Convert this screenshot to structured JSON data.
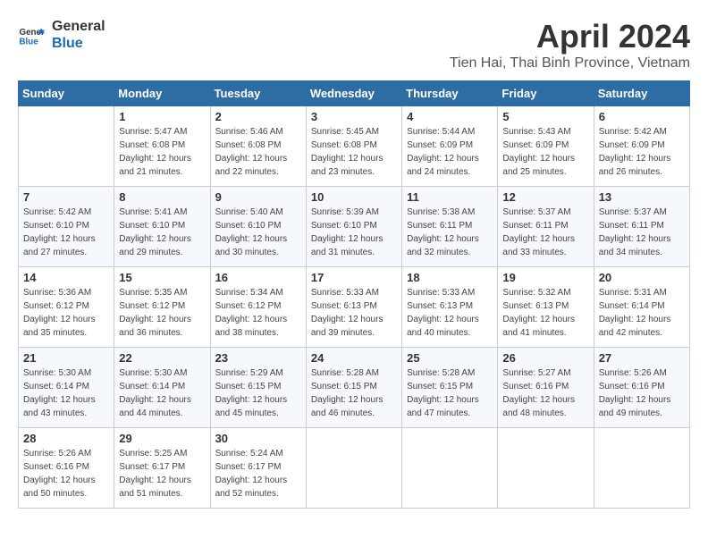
{
  "header": {
    "logo_line1": "General",
    "logo_line2": "Blue",
    "month_title": "April 2024",
    "location": "Tien Hai, Thai Binh Province, Vietnam"
  },
  "days_of_week": [
    "Sunday",
    "Monday",
    "Tuesday",
    "Wednesday",
    "Thursday",
    "Friday",
    "Saturday"
  ],
  "weeks": [
    [
      {
        "day": "",
        "sunrise": "",
        "sunset": "",
        "daylight": ""
      },
      {
        "day": "1",
        "sunrise": "Sunrise: 5:47 AM",
        "sunset": "Sunset: 6:08 PM",
        "daylight": "Daylight: 12 hours and 21 minutes."
      },
      {
        "day": "2",
        "sunrise": "Sunrise: 5:46 AM",
        "sunset": "Sunset: 6:08 PM",
        "daylight": "Daylight: 12 hours and 22 minutes."
      },
      {
        "day": "3",
        "sunrise": "Sunrise: 5:45 AM",
        "sunset": "Sunset: 6:08 PM",
        "daylight": "Daylight: 12 hours and 23 minutes."
      },
      {
        "day": "4",
        "sunrise": "Sunrise: 5:44 AM",
        "sunset": "Sunset: 6:09 PM",
        "daylight": "Daylight: 12 hours and 24 minutes."
      },
      {
        "day": "5",
        "sunrise": "Sunrise: 5:43 AM",
        "sunset": "Sunset: 6:09 PM",
        "daylight": "Daylight: 12 hours and 25 minutes."
      },
      {
        "day": "6",
        "sunrise": "Sunrise: 5:42 AM",
        "sunset": "Sunset: 6:09 PM",
        "daylight": "Daylight: 12 hours and 26 minutes."
      }
    ],
    [
      {
        "day": "7",
        "sunrise": "Sunrise: 5:42 AM",
        "sunset": "Sunset: 6:10 PM",
        "daylight": "Daylight: 12 hours and 27 minutes."
      },
      {
        "day": "8",
        "sunrise": "Sunrise: 5:41 AM",
        "sunset": "Sunset: 6:10 PM",
        "daylight": "Daylight: 12 hours and 29 minutes."
      },
      {
        "day": "9",
        "sunrise": "Sunrise: 5:40 AM",
        "sunset": "Sunset: 6:10 PM",
        "daylight": "Daylight: 12 hours and 30 minutes."
      },
      {
        "day": "10",
        "sunrise": "Sunrise: 5:39 AM",
        "sunset": "Sunset: 6:10 PM",
        "daylight": "Daylight: 12 hours and 31 minutes."
      },
      {
        "day": "11",
        "sunrise": "Sunrise: 5:38 AM",
        "sunset": "Sunset: 6:11 PM",
        "daylight": "Daylight: 12 hours and 32 minutes."
      },
      {
        "day": "12",
        "sunrise": "Sunrise: 5:37 AM",
        "sunset": "Sunset: 6:11 PM",
        "daylight": "Daylight: 12 hours and 33 minutes."
      },
      {
        "day": "13",
        "sunrise": "Sunrise: 5:37 AM",
        "sunset": "Sunset: 6:11 PM",
        "daylight": "Daylight: 12 hours and 34 minutes."
      }
    ],
    [
      {
        "day": "14",
        "sunrise": "Sunrise: 5:36 AM",
        "sunset": "Sunset: 6:12 PM",
        "daylight": "Daylight: 12 hours and 35 minutes."
      },
      {
        "day": "15",
        "sunrise": "Sunrise: 5:35 AM",
        "sunset": "Sunset: 6:12 PM",
        "daylight": "Daylight: 12 hours and 36 minutes."
      },
      {
        "day": "16",
        "sunrise": "Sunrise: 5:34 AM",
        "sunset": "Sunset: 6:12 PM",
        "daylight": "Daylight: 12 hours and 38 minutes."
      },
      {
        "day": "17",
        "sunrise": "Sunrise: 5:33 AM",
        "sunset": "Sunset: 6:13 PM",
        "daylight": "Daylight: 12 hours and 39 minutes."
      },
      {
        "day": "18",
        "sunrise": "Sunrise: 5:33 AM",
        "sunset": "Sunset: 6:13 PM",
        "daylight": "Daylight: 12 hours and 40 minutes."
      },
      {
        "day": "19",
        "sunrise": "Sunrise: 5:32 AM",
        "sunset": "Sunset: 6:13 PM",
        "daylight": "Daylight: 12 hours and 41 minutes."
      },
      {
        "day": "20",
        "sunrise": "Sunrise: 5:31 AM",
        "sunset": "Sunset: 6:14 PM",
        "daylight": "Daylight: 12 hours and 42 minutes."
      }
    ],
    [
      {
        "day": "21",
        "sunrise": "Sunrise: 5:30 AM",
        "sunset": "Sunset: 6:14 PM",
        "daylight": "Daylight: 12 hours and 43 minutes."
      },
      {
        "day": "22",
        "sunrise": "Sunrise: 5:30 AM",
        "sunset": "Sunset: 6:14 PM",
        "daylight": "Daylight: 12 hours and 44 minutes."
      },
      {
        "day": "23",
        "sunrise": "Sunrise: 5:29 AM",
        "sunset": "Sunset: 6:15 PM",
        "daylight": "Daylight: 12 hours and 45 minutes."
      },
      {
        "day": "24",
        "sunrise": "Sunrise: 5:28 AM",
        "sunset": "Sunset: 6:15 PM",
        "daylight": "Daylight: 12 hours and 46 minutes."
      },
      {
        "day": "25",
        "sunrise": "Sunrise: 5:28 AM",
        "sunset": "Sunset: 6:15 PM",
        "daylight": "Daylight: 12 hours and 47 minutes."
      },
      {
        "day": "26",
        "sunrise": "Sunrise: 5:27 AM",
        "sunset": "Sunset: 6:16 PM",
        "daylight": "Daylight: 12 hours and 48 minutes."
      },
      {
        "day": "27",
        "sunrise": "Sunrise: 5:26 AM",
        "sunset": "Sunset: 6:16 PM",
        "daylight": "Daylight: 12 hours and 49 minutes."
      }
    ],
    [
      {
        "day": "28",
        "sunrise": "Sunrise: 5:26 AM",
        "sunset": "Sunset: 6:16 PM",
        "daylight": "Daylight: 12 hours and 50 minutes."
      },
      {
        "day": "29",
        "sunrise": "Sunrise: 5:25 AM",
        "sunset": "Sunset: 6:17 PM",
        "daylight": "Daylight: 12 hours and 51 minutes."
      },
      {
        "day": "30",
        "sunrise": "Sunrise: 5:24 AM",
        "sunset": "Sunset: 6:17 PM",
        "daylight": "Daylight: 12 hours and 52 minutes."
      },
      {
        "day": "",
        "sunrise": "",
        "sunset": "",
        "daylight": ""
      },
      {
        "day": "",
        "sunrise": "",
        "sunset": "",
        "daylight": ""
      },
      {
        "day": "",
        "sunrise": "",
        "sunset": "",
        "daylight": ""
      },
      {
        "day": "",
        "sunrise": "",
        "sunset": "",
        "daylight": ""
      }
    ]
  ]
}
